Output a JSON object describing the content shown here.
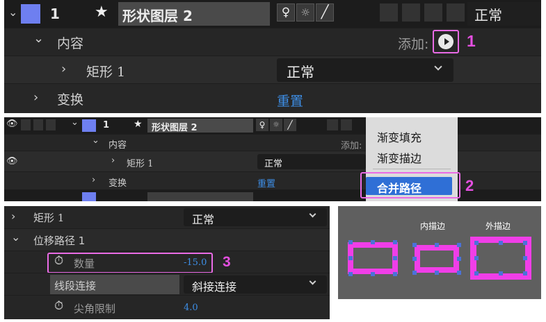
{
  "panel1": {
    "layer_index": "1",
    "layer_name": "形状图层 2",
    "mode": "正常",
    "contents_label": "内容",
    "add_label": "添加:",
    "rect_label": "矩形 1",
    "rect_mode": "正常",
    "transform_label": "变换",
    "reset_label": "重置",
    "step": "1"
  },
  "panel2": {
    "layer_index": "1",
    "layer_name": "形状图层 2",
    "contents_label": "内容",
    "add_label": "添加:",
    "rect_label": "矩形 1",
    "rect_mode": "正常",
    "transform_label": "变换",
    "reset_label": "重置",
    "menu": {
      "item1": "渐变填充",
      "item2": "渐变描边",
      "item3": "合并路径"
    },
    "step": "2"
  },
  "panel3": {
    "rect_label": "矩形 1",
    "rect_mode": "正常",
    "offset_label": "位移路径 1",
    "amount_label": "数量",
    "amount_value": "-15.0",
    "join_label": "线段连接",
    "join_value": "斜接连接",
    "miter_label": "尖角限制",
    "miter_value": "4.0",
    "step": "3"
  },
  "panel4": {
    "label_inner": "内描边",
    "label_outer": "外描边"
  },
  "colors": {
    "accent_pink": "#e96be5",
    "label_blue": "#6e7ff0",
    "link_blue": "#3d8ee6",
    "menu_highlight": "#2f6fd6",
    "handle_blue": "#4b72d9"
  }
}
